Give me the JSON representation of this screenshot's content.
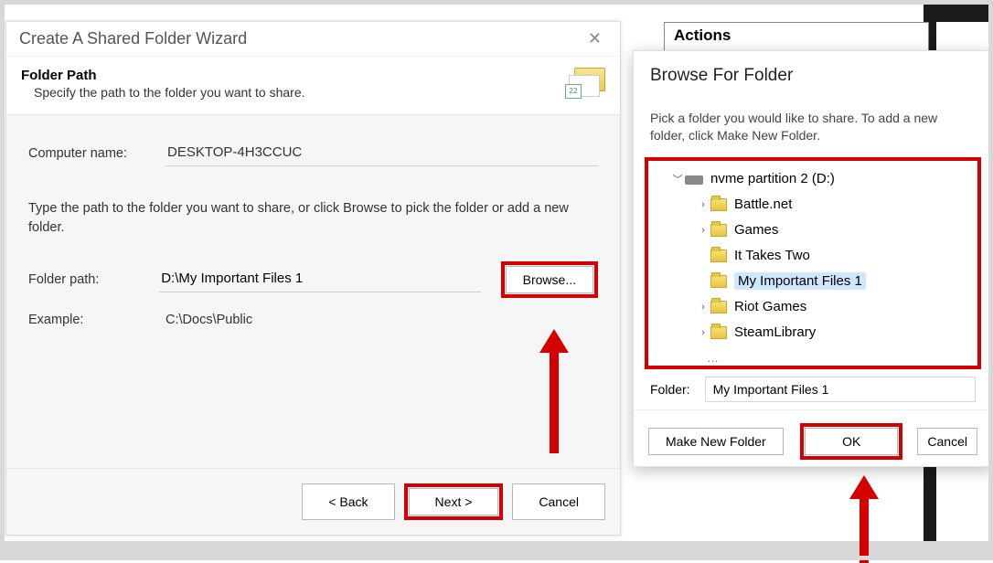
{
  "actions_header": "Actions",
  "wizard": {
    "title": "Create A Shared Folder Wizard",
    "header_title": "Folder Path",
    "header_sub": "Specify the path to the folder you want to share.",
    "computer_label": "Computer name:",
    "computer_value": "DESKTOP-4H3CCUC",
    "instruction": "Type the path to the folder you want to share, or click Browse to pick the folder or add a new folder.",
    "folder_path_label": "Folder path:",
    "folder_path_value": "D:\\My Important Files 1",
    "browse_label": "Browse...",
    "example_label": "Example:",
    "example_value": "C:\\Docs\\Public",
    "back_label": "< Back",
    "next_label": "Next >",
    "cancel_label": "Cancel",
    "folder_icon_badge": "22"
  },
  "browse": {
    "title": "Browse For Folder",
    "instruction": "Pick a folder you would like to share. To add a new folder, click Make New Folder.",
    "drive_label": "nvme partition 2 (D:)",
    "items": {
      "0": "Battle.net",
      "1": "Games",
      "2": "It Takes Two",
      "3": "My Important Files 1",
      "4": "Riot Games",
      "5": "SteamLibrary"
    },
    "folder_label": "Folder:",
    "folder_value": "My Important Files 1",
    "make_new_label": "Make New Folder",
    "ok_label": "OK",
    "cancel_label": "Cancel"
  }
}
